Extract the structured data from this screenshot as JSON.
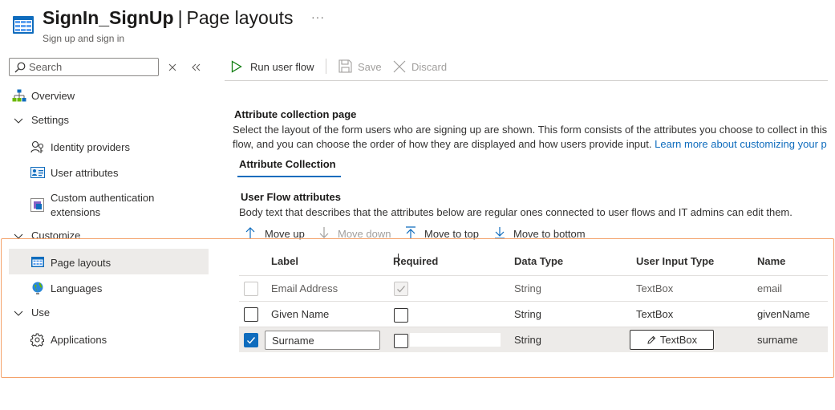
{
  "header": {
    "title": "SignIn_SignUp",
    "separator": "|",
    "page": "Page layouts",
    "more_label": "···",
    "subtitle": "Sign up and sign in"
  },
  "search": {
    "placeholder": "Search",
    "value": ""
  },
  "sidebar": {
    "items": [
      {
        "label": "Overview",
        "icon": "overview-icon"
      },
      {
        "label": "Settings",
        "icon": "chevron-down-icon",
        "group": true
      },
      {
        "label": "Identity providers",
        "icon": "identity-providers-icon"
      },
      {
        "label": "User attributes",
        "icon": "user-attributes-icon"
      },
      {
        "label": "Custom authentication",
        "label2": "extensions",
        "icon": "custom-extensions-icon"
      },
      {
        "label": "Customize",
        "icon": "chevron-down-icon",
        "group": true
      },
      {
        "label": "Page layouts",
        "icon": "page-layouts-icon",
        "selected": true
      },
      {
        "label": "Languages",
        "icon": "globe-icon"
      },
      {
        "label": "Use",
        "icon": "chevron-down-icon",
        "group": true
      },
      {
        "label": "Applications",
        "icon": "gear-icon"
      }
    ]
  },
  "toolbar": {
    "run_label": "Run user flow",
    "save_label": "Save",
    "discard_label": "Discard"
  },
  "main": {
    "section_title": "Attribute collection page",
    "description_line1": "Select the layout of the form users who are signing up are shown. This form consists of the attributes you choose to collect in this",
    "description_line2": "flow, and you can choose the order of how they are displayed and how users provide input.",
    "link_text": "Learn more about customizing your p",
    "tab_label": "Attribute Collection",
    "subsection_title": "User Flow attributes",
    "subsection_desc": "Body text that describes that the attributes below are regular ones connected to user flows and IT admins can edit them.",
    "move": {
      "up": "Move up",
      "down": "Move down",
      "top": "Move to top",
      "bottom": "Move to bottom"
    }
  },
  "table": {
    "headers": {
      "label": "Label",
      "required": "Required",
      "data_type": "Data Type",
      "input_type": "User Input Type",
      "name": "Name"
    },
    "rows": [
      {
        "label": "Email Address",
        "required": true,
        "data_type": "String",
        "input_type": "TextBox",
        "name": "email",
        "selected": false,
        "disabled": true
      },
      {
        "label": "Given Name",
        "required": false,
        "data_type": "String",
        "input_type": "TextBox",
        "name": "givenName",
        "selected": false,
        "disabled": false
      },
      {
        "label": "Surname",
        "required": false,
        "data_type": "String",
        "input_type": "TextBox",
        "name": "surname",
        "selected": true,
        "disabled": false
      }
    ]
  },
  "colors": {
    "accent": "#0f6cbd",
    "run_green": "#107c10",
    "highlight": "#f4a26b",
    "selected_bg": "#edebe9"
  }
}
